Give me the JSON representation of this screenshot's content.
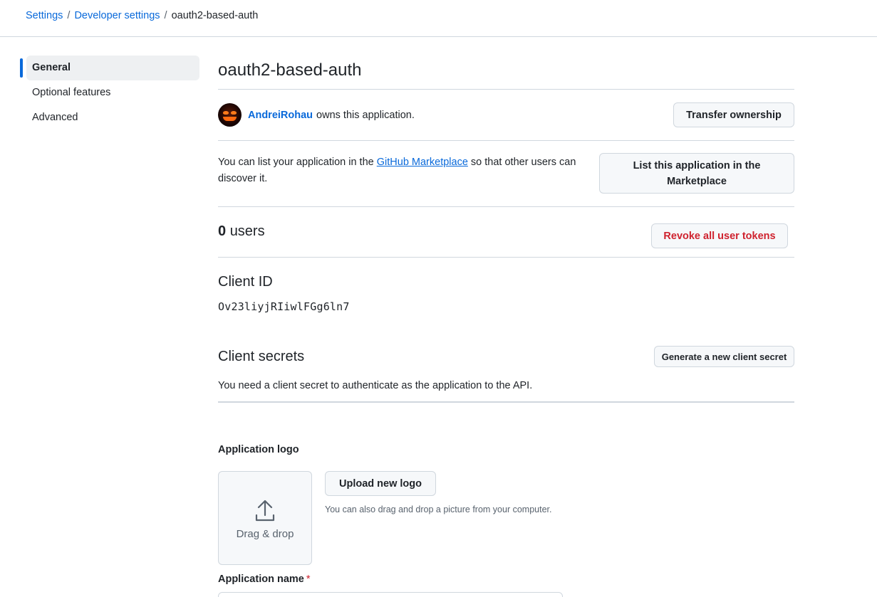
{
  "breadcrumb": {
    "settings": "Settings",
    "developer_settings": "Developer settings",
    "current": "oauth2-based-auth",
    "separator": "/"
  },
  "sidebar": {
    "items": [
      {
        "label": "General",
        "active": true
      },
      {
        "label": "Optional features",
        "active": false
      },
      {
        "label": "Advanced",
        "active": false
      }
    ]
  },
  "app": {
    "title": "oauth2-based-auth",
    "owner": {
      "name": "AndreiRohau",
      "suffix": "owns this application.",
      "transfer_label": "Transfer ownership"
    },
    "marketplace": {
      "text_before": "You can list your application in the ",
      "link": "GitHub Marketplace",
      "text_after": " so that other users can discover it.",
      "button_label": "List this application in the Marketplace"
    },
    "users": {
      "count": "0",
      "label": "users",
      "revoke_label": "Revoke all user tokens"
    },
    "client_id": {
      "heading": "Client ID",
      "value": "Ov23liyjRIiwlFGg6ln7"
    },
    "client_secrets": {
      "heading": "Client secrets",
      "button_label": "Generate a new client secret",
      "description": "You need a client secret to authenticate as the application to the API."
    },
    "logo": {
      "label": "Application logo",
      "drop_label": "Drag & drop",
      "upload_label": "Upload new logo",
      "note": "You can also drag and drop a picture from your computer."
    },
    "name_field": {
      "label": "Application name",
      "required_mark": "*",
      "value": ""
    }
  },
  "colors": {
    "link": "#0969da",
    "danger": "#cf222e",
    "border": "#d0d7de",
    "button_bg": "#f6f8fa",
    "active_bg": "#eef0f2"
  }
}
